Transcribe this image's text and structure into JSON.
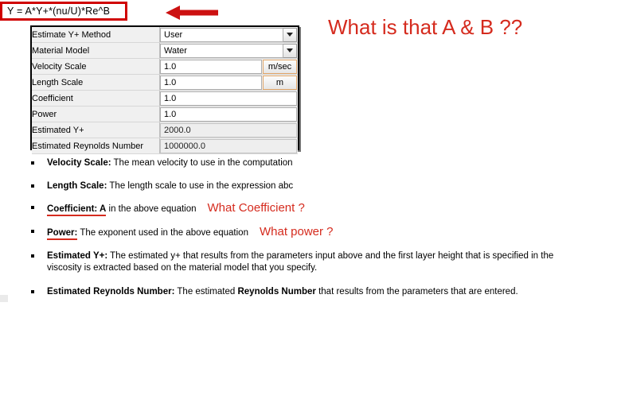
{
  "formula": {
    "text": "Y = A*Y+*(nu/U)*Re^B"
  },
  "annotations": {
    "headline_question": "What is that A & B ??",
    "coefficient_note": "What Coefficient ?",
    "power_note": "What power ?",
    "arrow_icon": "left-arrow-icon",
    "accent_color": "#d52b1e",
    "box_border_color": "#d00000"
  },
  "param_panel": {
    "rows": [
      {
        "label": "Estimate Y+ Method",
        "value": "User",
        "control": "dropdown",
        "unit": ""
      },
      {
        "label": "Material Model",
        "value": "Water",
        "control": "dropdown",
        "unit": ""
      },
      {
        "label": "Velocity Scale",
        "value": "1.0",
        "control": "text-with-unit",
        "unit": "m/sec"
      },
      {
        "label": "Length Scale",
        "value": "1.0",
        "control": "text-with-unit",
        "unit": "m"
      },
      {
        "label": "Coefficient",
        "value": "1.0",
        "control": "text",
        "unit": ""
      },
      {
        "label": "Power",
        "value": "1.0",
        "control": "text",
        "unit": ""
      },
      {
        "label": "Estimated Y+",
        "value": "2000.0",
        "control": "readonly",
        "unit": ""
      },
      {
        "label": "Estimated Reynolds Number",
        "value": "1000000.0",
        "control": "readonly",
        "unit": ""
      }
    ]
  },
  "bullets": {
    "velocity": {
      "term": "Velocity Scale:",
      "desc": " The mean velocity to use in the computation"
    },
    "length": {
      "term": "Length Scale:",
      "desc": " The length scale to use in the expression abc"
    },
    "coefficient": {
      "term": "Coefficient: A",
      "desc": " in the above equation"
    },
    "power": {
      "term": "Power:",
      "desc": " The exponent used in the above equation"
    },
    "estimated_yplus": {
      "term": "Estimated Y+:",
      "desc": " The estimated y+ that results from the parameters input above and the first layer height that is specified in the",
      "desc2": "viscosity is extracted based on the material model that you specify."
    },
    "reynolds": {
      "term": "Estimated Reynolds Number:",
      "desc_a": " The estimated ",
      "desc_bold": "Reynolds Number",
      "desc_b": " that results from the parameters that are entered."
    }
  }
}
